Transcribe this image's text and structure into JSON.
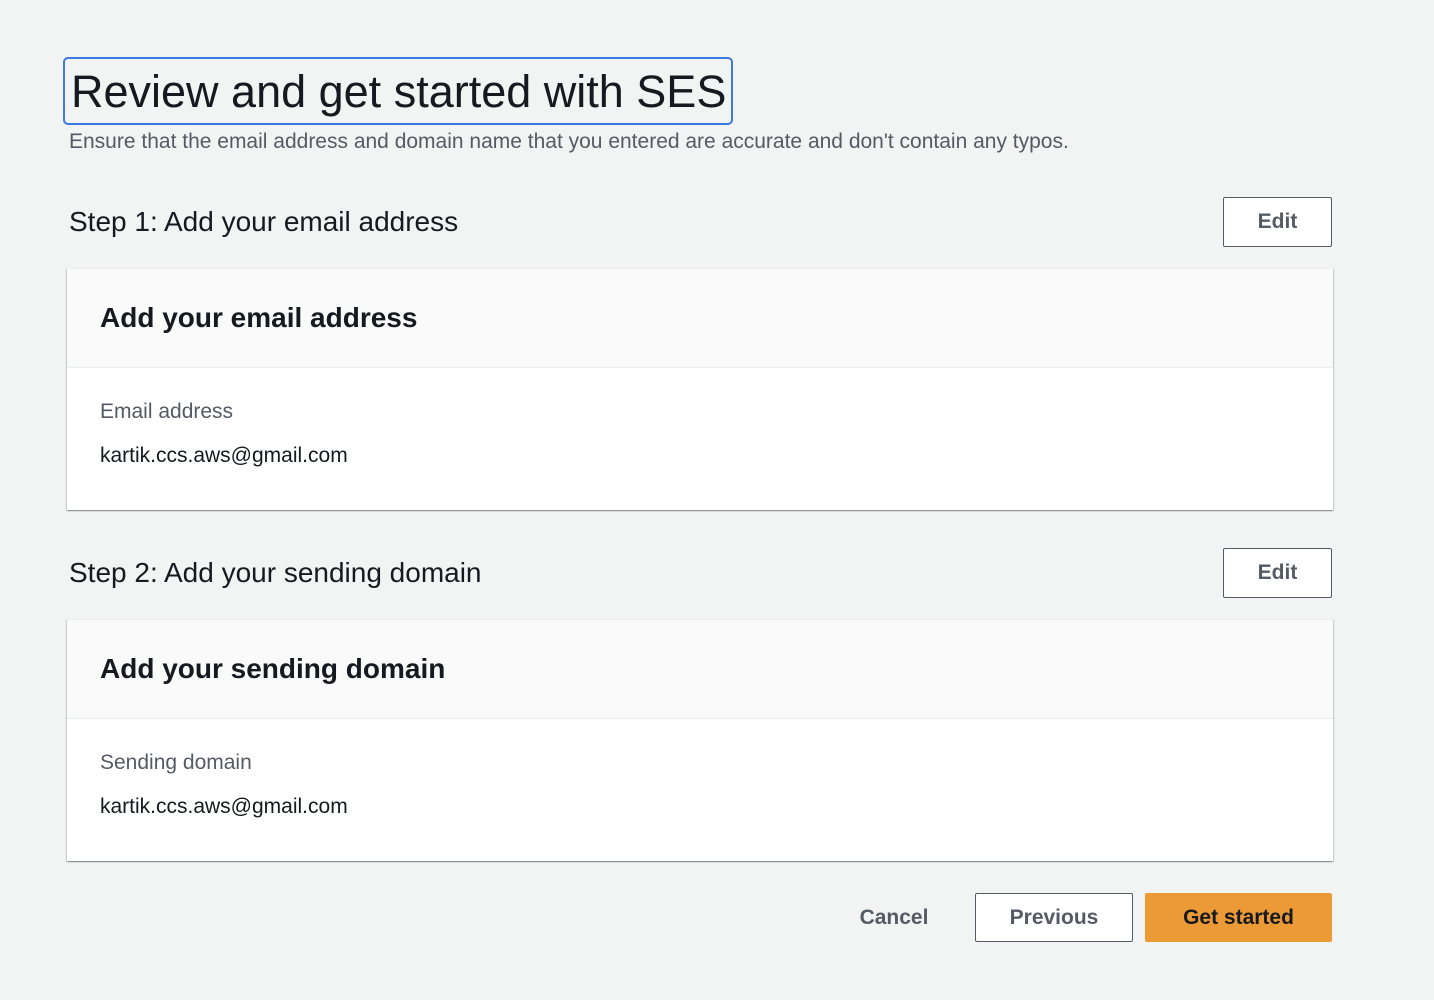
{
  "page": {
    "title": "Review and get started with SES",
    "description": "Ensure that the email address and domain name that you entered are accurate and don't contain any typos."
  },
  "steps": [
    {
      "header": "Step 1: Add your email address",
      "edit_label": "Edit",
      "container_title": "Add your email address",
      "field_label": "Email address",
      "field_value": "kartik.ccs.aws@gmail.com"
    },
    {
      "header": "Step 2: Add your sending domain",
      "edit_label": "Edit",
      "container_title": "Add your sending domain",
      "field_label": "Sending domain",
      "field_value": "kartik.ccs.aws@gmail.com"
    }
  ],
  "footer": {
    "cancel_label": "Cancel",
    "previous_label": "Previous",
    "primary_label": "Get started"
  },
  "colors": {
    "background": "#f2f3f3",
    "primary_button": "#ec9a35",
    "focus_ring": "#3b7ae0",
    "text_primary": "#16191f",
    "text_secondary": "#545b64"
  }
}
